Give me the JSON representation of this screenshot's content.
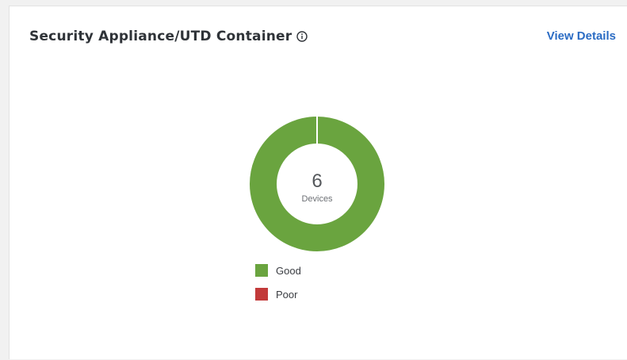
{
  "card": {
    "title": "Security Appliance/UTD Container",
    "info_icon": "info-circle-icon",
    "view_details_label": "View Details"
  },
  "colors": {
    "good": "#6aa43f",
    "poor": "#c23a3a",
    "link": "#2b6cc4"
  },
  "chart_data": {
    "type": "pie",
    "center_value": "6",
    "center_label": "Devices",
    "categories": [
      "Good",
      "Poor"
    ],
    "values": [
      6,
      0
    ],
    "colors": [
      "#6aa43f",
      "#c23a3a"
    ],
    "legend_position": "bottom"
  },
  "legend": {
    "items": [
      {
        "label": "Good",
        "color": "#6aa43f"
      },
      {
        "label": "Poor",
        "color": "#c23a3a"
      }
    ]
  }
}
